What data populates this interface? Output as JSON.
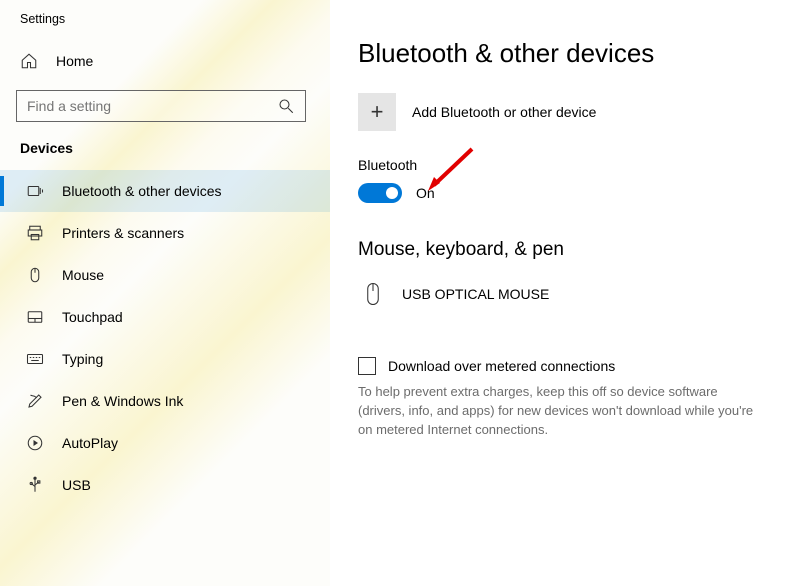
{
  "app_title": "Settings",
  "home": {
    "label": "Home"
  },
  "search": {
    "placeholder": "Find a setting"
  },
  "sidebar": {
    "section": "Devices",
    "items": [
      {
        "label": "Bluetooth & other devices"
      },
      {
        "label": "Printers & scanners"
      },
      {
        "label": "Mouse"
      },
      {
        "label": "Touchpad"
      },
      {
        "label": "Typing"
      },
      {
        "label": "Pen & Windows Ink"
      },
      {
        "label": "AutoPlay"
      },
      {
        "label": "USB"
      }
    ]
  },
  "main": {
    "title": "Bluetooth & other devices",
    "add_label": "Add Bluetooth or other device",
    "bluetooth_label": "Bluetooth",
    "toggle_state": "On",
    "group_title": "Mouse, keyboard, & pen",
    "device_name": "USB OPTICAL MOUSE",
    "checkbox_label": "Download over metered connections",
    "help_text": "To help prevent extra charges, keep this off so device software (drivers, info, and apps) for new devices won't download while you're on metered Internet connections."
  }
}
